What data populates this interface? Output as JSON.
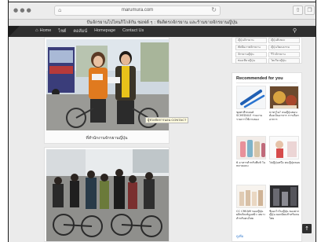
{
  "browser": {
    "url": "marumura.com",
    "page_title": "ปั่นจักรยานไปไหนก็ใกล้กัน ซอฟต์ ๆ : ที่ผลิตรถจักรยาน และร้านขายจักรยานญี่ปุ่น"
  },
  "nav": {
    "items": [
      "Home",
      "ไซต์",
      "คอลัมน์",
      "Homepage",
      "Contact Us"
    ]
  },
  "post1": {
    "caption": "ที่สำนักงานจักรยานญี่ปุ่น",
    "tooltip": "ผู้ช่วยจัดการนอน CONTACT"
  },
  "sidebar": {
    "tags": [
      "ญี่ปุ่นจักรยาน",
      "ญี่ปุ่นทิ้งขยะ",
      "ทัศนียภาพจักรยาน",
      "ญี่ปุ่นวัฒนธรรม",
      "จักรยานญี่ปุ่น",
      "รีวิวจักรยาน",
      "ท่องเที่ยวญี่ปุ่น",
      "โตเกียวญี่ปุ่น"
    ],
    "recommended_title": "Recommended for you",
    "items": [
      {
        "text": "ชุดทาสีรถยนต์ SCHEDULE ร่วมงาน รายการใช้งานของ"
      },
      {
        "text": "น่าทาไม? คนญี่ปุ่นชอบ ต้องเป็นอาหาร การเลือกอาหาร"
      },
      {
        "text": "6 อาหารสำหรับที่แท้ ในหลายแบบ"
      },
      {
        "text": "ไปญี่ปุ่นหนึ่ง คนญี่ปุ่นชอบ"
      },
      {
        "text": "CC CREAM ของญี่ปุ่น ผลิตภัณฑ์ดูแลผิว เหมาะสำหรับคนไทย"
      },
      {
        "text": "ซื้ออะไรในญี่ปุ่น ของฝากญี่ปุ่น ยอดนิยมสำหรับคนไทย"
      }
    ],
    "more_label": "ดูเพิ่ม"
  },
  "colors": {
    "nav_bg": "#2f2f2f",
    "page_bg": "#ebebeb",
    "link": "#3a7fd0"
  }
}
